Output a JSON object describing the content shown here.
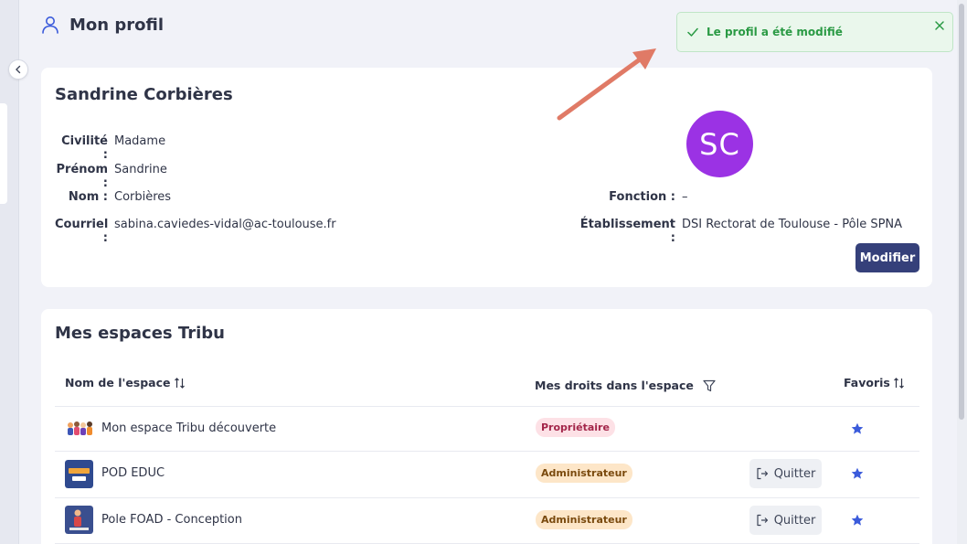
{
  "header": {
    "title": "Mon profil",
    "icon": "user-icon"
  },
  "toast": {
    "message": "Le profil a été modifié",
    "color": "#2a9a44"
  },
  "profile": {
    "name": "Sandrine Corbières",
    "avatar_initials": "SC",
    "avatar_color": "#9b32e4",
    "fields": {
      "civilite": {
        "label": "Civilité :",
        "value": "Madame"
      },
      "prenom": {
        "label": "Prénom :",
        "value": "Sandrine"
      },
      "nom": {
        "label": "Nom :",
        "value": "Corbières"
      },
      "courriel": {
        "label": "Courriel :",
        "value": "sabina.caviedes-vidal@ac-toulouse.fr"
      },
      "fonction": {
        "label": "Fonction :",
        "value": "–"
      },
      "etablissement": {
        "label": "Établissement :",
        "value": "DSI Rectorat de Toulouse - Pôle SPNA"
      }
    },
    "edit_label": "Modifier",
    "accent": "#35407a"
  },
  "spaces": {
    "title": "Mes espaces Tribu",
    "columns": {
      "name": "Nom de l'espace",
      "rights": "Mes droits dans l'espace",
      "favorites": "Favoris"
    },
    "rows": [
      {
        "name": "Mon espace Tribu découverte",
        "role": "Propriétaire",
        "action": "",
        "favorite": true
      },
      {
        "name": "POD EDUC",
        "role": "Administrateur",
        "action": "Quitter",
        "favorite": true
      },
      {
        "name": "Pole FOAD - Conception",
        "role": "Administrateur",
        "action": "Quitter",
        "favorite": true
      }
    ]
  }
}
